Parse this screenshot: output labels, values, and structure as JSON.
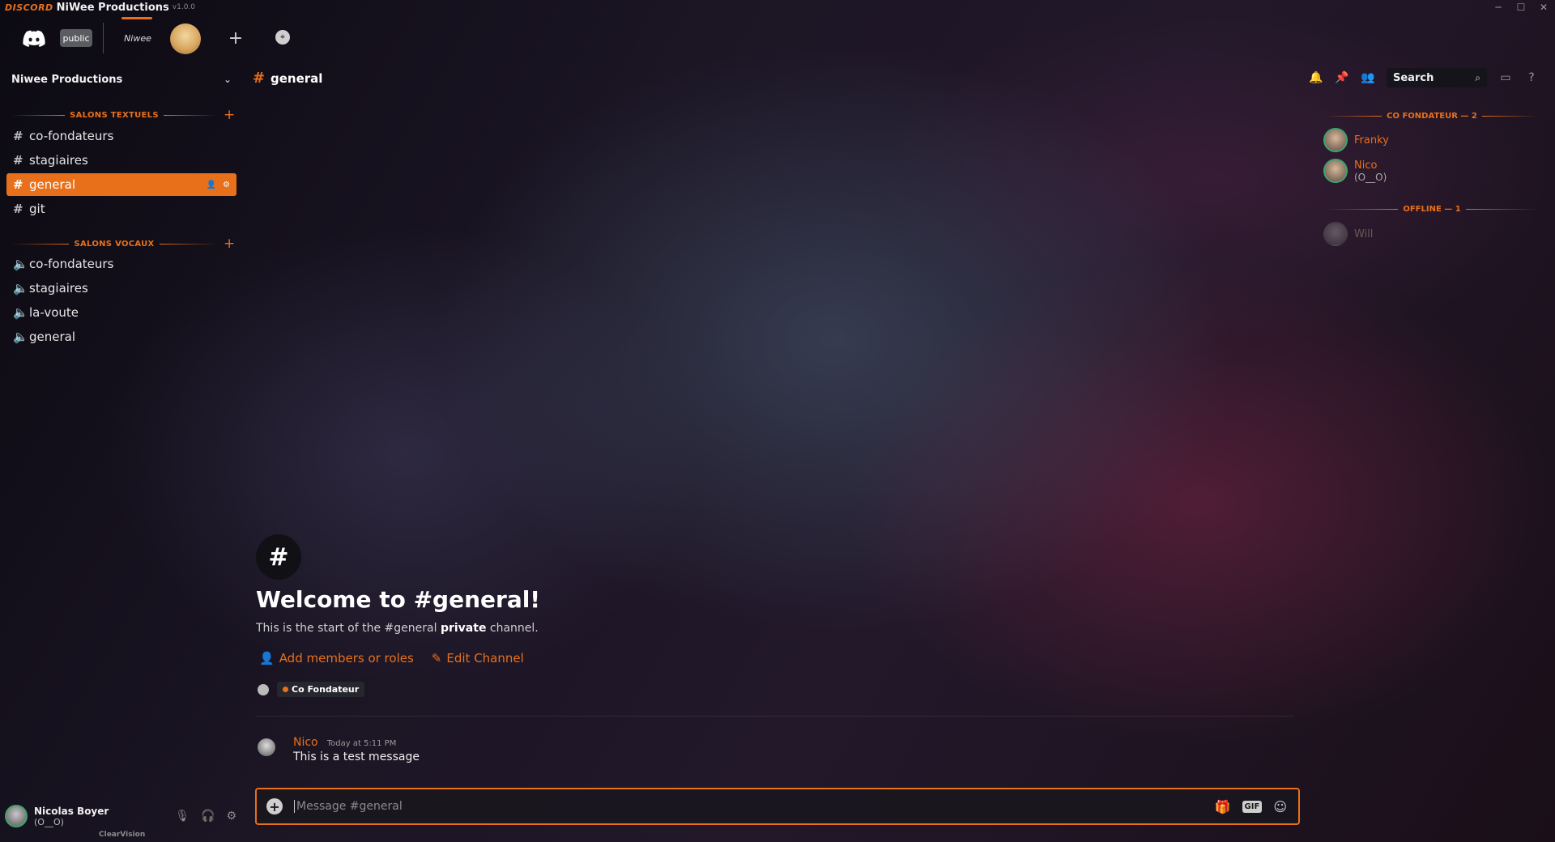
{
  "titlebar": {
    "brand": "DISCORD",
    "title": "NiWee Productions",
    "version": "v1.0.0",
    "controls": [
      "─",
      "☐",
      "✕"
    ]
  },
  "guilds": {
    "public_label": "public",
    "niwee_label": "Niwee",
    "add_label": "+",
    "explore_label": "⌖"
  },
  "sidebar": {
    "server_name": "Niwee Productions",
    "text_category": "SALONS TEXTUELS",
    "voice_category": "SALONS VOCAUX",
    "text_channels": [
      {
        "label": "co-fondateurs",
        "icon": "hash-lock-icon"
      },
      {
        "label": "stagiaires",
        "icon": "hash-lock-icon"
      },
      {
        "label": "general",
        "icon": "hash-lock-icon",
        "active": true
      },
      {
        "label": "git",
        "icon": "hash-lock-icon"
      }
    ],
    "voice_channels": [
      {
        "label": "co-fondateurs",
        "icon": "speaker-lock-icon"
      },
      {
        "label": "stagiaires",
        "icon": "speaker-lock-icon"
      },
      {
        "label": "la-voute",
        "icon": "speaker-lock-icon"
      },
      {
        "label": "general",
        "icon": "speaker-icon"
      }
    ]
  },
  "user": {
    "name": "Nicolas Boyer",
    "tag": "(O__O)",
    "theme": "ClearVision"
  },
  "header": {
    "channel_name": "general",
    "search_placeholder": "Search"
  },
  "welcome": {
    "title": "Welcome to #general!",
    "subtitle_prefix": "This is the start of the #general",
    "subtitle_bold": "private",
    "subtitle_suffix": "channel.",
    "add_members": "Add members or roles",
    "edit_channel": "Edit Channel",
    "role": "Co Fondateur"
  },
  "message": {
    "author": "Nico",
    "time": "Today at 5:11 PM",
    "text": "This is a test message"
  },
  "composer": {
    "placeholder": "Message #general",
    "gif_label": "GIF"
  },
  "members": {
    "cofounder_category": "CO FONDATEUR — 2",
    "offline_category": "OFFLINE — 1",
    "online": [
      {
        "name": "Franky",
        "sub": ""
      },
      {
        "name": "Nico",
        "sub": "(O__O)"
      }
    ],
    "offline": [
      {
        "name": "Will"
      }
    ]
  },
  "colors": {
    "accent": "#e8701a",
    "online": "#3ea36e"
  }
}
